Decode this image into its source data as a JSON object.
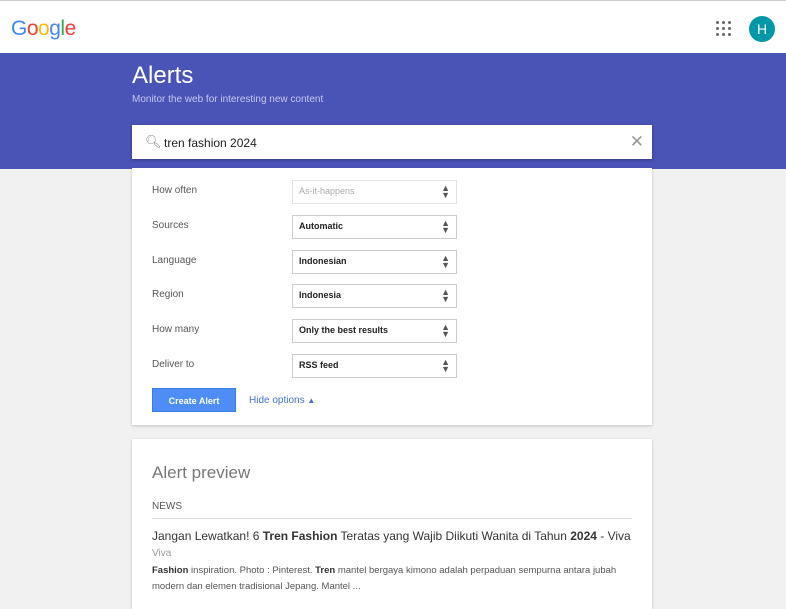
{
  "header": {
    "logo": "Google",
    "avatar_letter": "H"
  },
  "banner": {
    "title": "Alerts",
    "subtitle": "Monitor the web for interesting new content"
  },
  "search": {
    "query": "tren fashion 2024"
  },
  "options": [
    {
      "label": "How often",
      "value": "As-it-happens",
      "disabled": true
    },
    {
      "label": "Sources",
      "value": "Automatic"
    },
    {
      "label": "Language",
      "value": "Indonesian"
    },
    {
      "label": "Region",
      "value": "Indonesia"
    },
    {
      "label": "How many",
      "value": "Only the best results"
    },
    {
      "label": "Deliver to",
      "value": "RSS feed"
    }
  ],
  "create_label": "Create Alert",
  "hide_label": "Hide options",
  "preview": {
    "heading": "Alert preview",
    "section": "NEWS",
    "result": {
      "title": [
        {
          "t": "Jangan Lewatkan! 6 "
        },
        {
          "t": "Tren Fashion",
          "b": true
        },
        {
          "t": " Teratas yang Wajib Diikuti Wanita di Tahun "
        },
        {
          "t": "2024",
          "b": true
        },
        {
          "t": " - Viva"
        }
      ],
      "source": "Viva",
      "snippet": [
        {
          "t": "Fashion",
          "b": true
        },
        {
          "t": " inspiration. Photo : Pinterest. "
        },
        {
          "t": "Tren",
          "b": true
        },
        {
          "t": " mantel bergaya kimono adalah perpaduan sempurna antara jubah modern dan elemen tradisional Jepang. Mantel ..."
        }
      ]
    }
  }
}
